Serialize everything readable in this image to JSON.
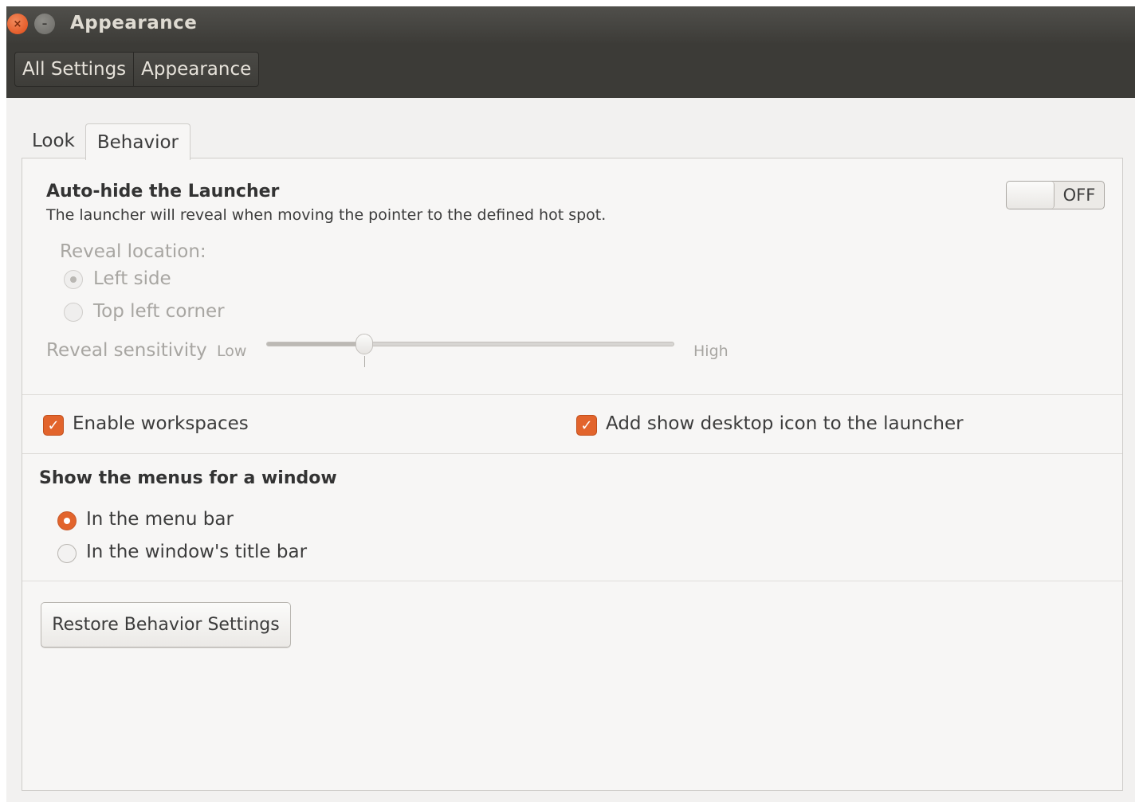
{
  "window": {
    "title": "Appearance",
    "close_glyph": "×",
    "minimize_glyph": "–"
  },
  "breadcrumbs": [
    "All Settings",
    "Appearance"
  ],
  "tabs": [
    {
      "label": "Look",
      "active": false
    },
    {
      "label": "Behavior",
      "active": true
    }
  ],
  "autohide": {
    "heading": "Auto-hide the Launcher",
    "description": "The launcher will reveal when moving the pointer to the defined hot spot.",
    "toggle_label": "OFF",
    "reveal_location_label": "Reveal location:",
    "options": [
      {
        "label": "Left side",
        "selected": true,
        "enabled": false
      },
      {
        "label": "Top left corner",
        "selected": false,
        "enabled": false
      }
    ],
    "sensitivity_label": "Reveal sensitivity",
    "sensitivity_low": "Low",
    "sensitivity_high": "High",
    "sensitivity_value": 0.24
  },
  "checks": {
    "workspaces_label": "Enable workspaces",
    "workspaces_checked": true,
    "show_desktop_label": "Add show desktop icon to the launcher",
    "show_desktop_checked": true,
    "check_glyph": "✓"
  },
  "menus": {
    "heading": "Show the menus for a window",
    "options": [
      {
        "label": "In the menu bar",
        "selected": true
      },
      {
        "label": "In the window's title bar",
        "selected": false
      }
    ]
  },
  "restore_button_label": "Restore Behavior Settings",
  "colors": {
    "accent": "#e2642c",
    "titlebar": "#3c3b37",
    "background": "#f2f1f0"
  }
}
